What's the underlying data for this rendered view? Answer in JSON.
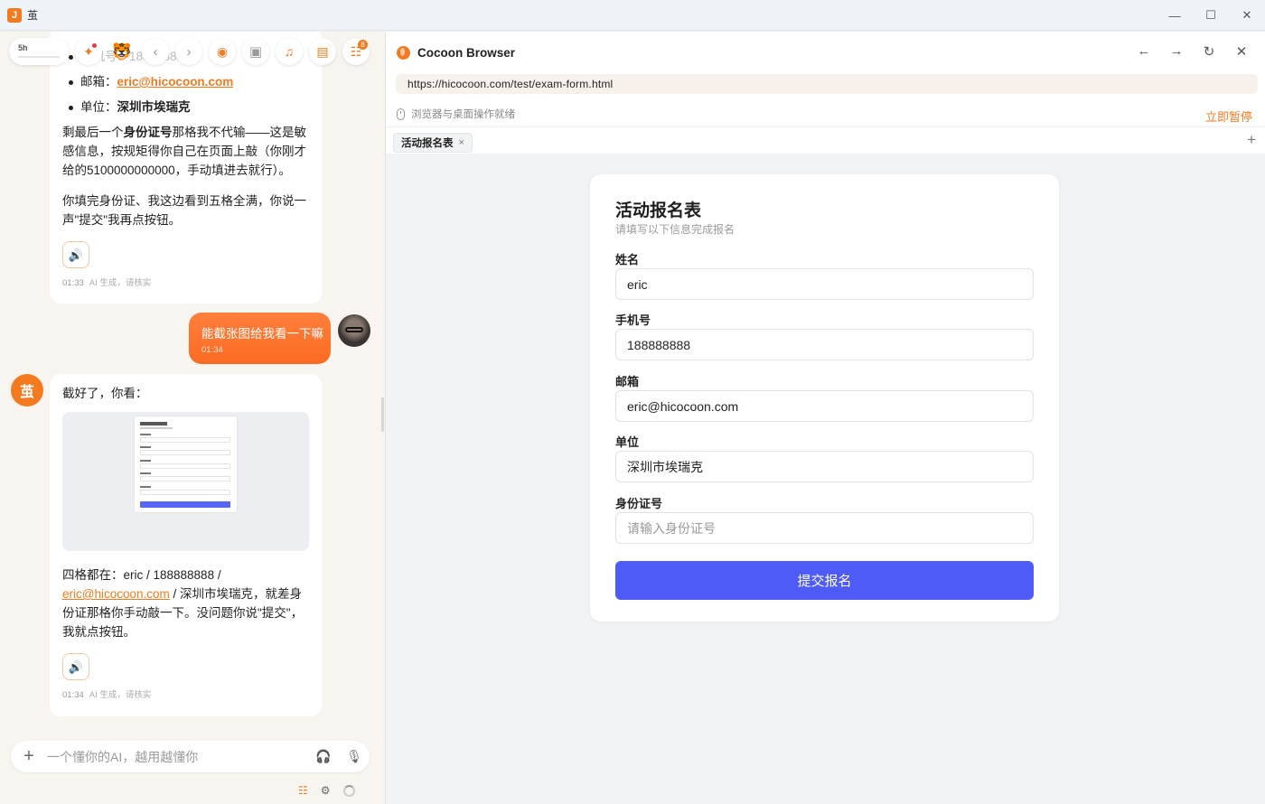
{
  "window": {
    "app_icon_char": "J",
    "title": "茧",
    "controls": [
      "—",
      "☐",
      "✕"
    ]
  },
  "chat": {
    "toolbar": {
      "usage_label": "5h",
      "badge_count": "8"
    },
    "msg_prev": {
      "faded_line": "手机号：188888888",
      "items": [
        {
          "label": "邮箱：",
          "value": "eric@hicocoon.com"
        },
        {
          "label": "单位：",
          "value": "深圳市埃瑞克"
        }
      ],
      "para1_a": "剩最后一个",
      "para1_bold": "身份证号",
      "para1_b": "那格我不代输——这是敏感信息，按规矩得你自己在页面上敲（你刚才给的5100000000000，手动填进去就行）。",
      "para2": "你填完身份证、我这边看到五格全满，你说一声\"提交\"我再点按钮。",
      "time": "01:33",
      "meta": "AI 生成，请核实"
    },
    "user_msg": {
      "text": "能截张图给我看一下嘛",
      "time": "01:34"
    },
    "ai_avatar_char": "茧",
    "msg_ai": {
      "intro": "截好了，你看：",
      "text_a": "四格都在：eric / 188888888 /",
      "link": "eric@hicocoon.com",
      "text_b": " / 深圳市埃瑞克，就差身份证那格你手动敲一下。没问题你说\"提交\"，我就点按钮。",
      "time": "01:34",
      "meta": "AI 生成，请核实"
    },
    "input": {
      "placeholder": "一个懂你的AI，越用越懂你",
      "plus": "+"
    }
  },
  "browser": {
    "title": "Cocoon Browser",
    "nav": [
      "←",
      "→",
      "↻",
      "✕"
    ],
    "url": "https://hicocoon.com/test/exam-form.html",
    "status": "浏览器与桌面操作就绪",
    "pause": "立即暂停",
    "tab": {
      "label": "活动报名表",
      "close": "×"
    },
    "new_tab": "+",
    "form": {
      "title": "活动报名表",
      "subtitle": "请填写以下信息完成报名",
      "fields": [
        {
          "label": "姓名",
          "value": "eric",
          "placeholder": ""
        },
        {
          "label": "手机号",
          "value": "188888888",
          "placeholder": ""
        },
        {
          "label": "邮箱",
          "value": "eric@hicocoon.com",
          "placeholder": ""
        },
        {
          "label": "单位",
          "value": "深圳市埃瑞克",
          "placeholder": ""
        },
        {
          "label": "身份证号",
          "value": "",
          "placeholder": "请输入身份证号"
        }
      ],
      "submit": "提交报名"
    }
  },
  "colors": {
    "accent": "#f47a1f",
    "submit": "#4f5bf6",
    "user_bubble": "#fb6b22"
  }
}
